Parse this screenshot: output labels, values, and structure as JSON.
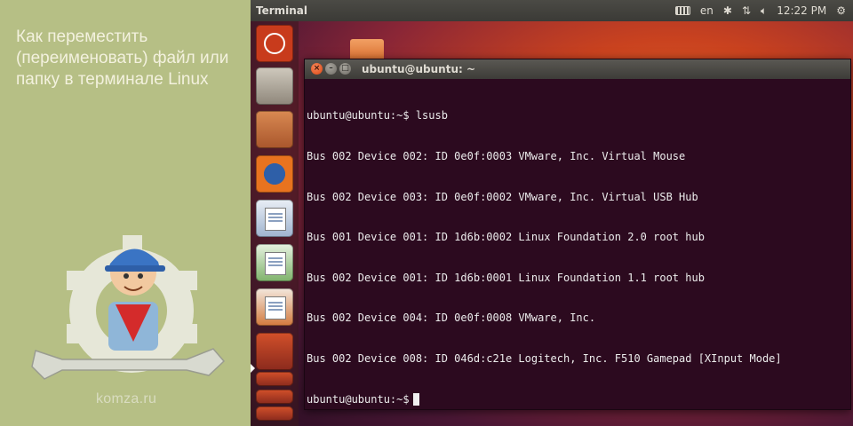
{
  "promo": {
    "title_lines": [
      "Как переместить",
      "(переименовать) файл или",
      "папку в терминале Linux"
    ],
    "site": "komza.ru"
  },
  "topbar": {
    "app_title": "Terminal",
    "keyboard_layout": "en",
    "time": "12:22 PM",
    "icons": [
      "keyboard-icon",
      "bluetooth-icon",
      "network-icon",
      "volume-icon",
      "power-icon"
    ]
  },
  "launcher": {
    "items": [
      "ubuntu-dash",
      "ubuntu-software-center",
      "files",
      "firefox",
      "libreoffice-writer",
      "libreoffice-calc",
      "libreoffice-impress",
      "stacked-apps"
    ]
  },
  "terminal": {
    "title": "ubuntu@ubuntu: ~",
    "lines": [
      "ubuntu@ubuntu:~$ lsusb",
      "Bus 002 Device 002: ID 0e0f:0003 VMware, Inc. Virtual Mouse",
      "Bus 002 Device 003: ID 0e0f:0002 VMware, Inc. Virtual USB Hub",
      "Bus 001 Device 001: ID 1d6b:0002 Linux Foundation 2.0 root hub",
      "Bus 002 Device 001: ID 1d6b:0001 Linux Foundation 1.1 root hub",
      "Bus 002 Device 004: ID 0e0f:0008 VMware, Inc.",
      "Bus 002 Device 008: ID 046d:c21e Logitech, Inc. F510 Gamepad [XInput Mode]"
    ],
    "prompt": "ubuntu@ubuntu:~$"
  },
  "colors": {
    "terminal_bg": "#2c0a1f",
    "ubuntu_orange": "#dd4814",
    "promo_bg": "#b6bf85"
  }
}
